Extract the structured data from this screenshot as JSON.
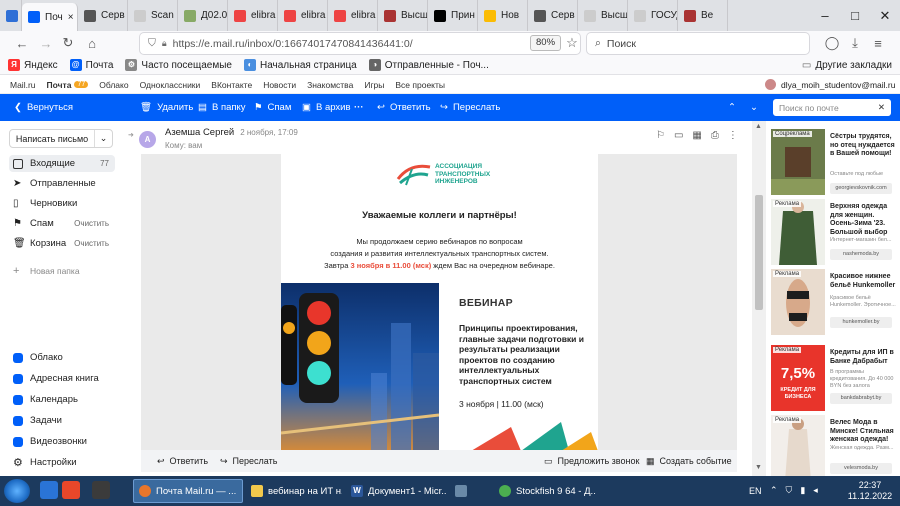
{
  "browser": {
    "tabs": [
      {
        "label": "",
        "fav": "#2f6fd6"
      },
      {
        "label": "Поч",
        "fav": "#005ff9",
        "active": true
      },
      {
        "label": "Серв",
        "fav": "#555"
      },
      {
        "label": "Scan о Д",
        "fav": "#ccc"
      },
      {
        "label": "Д02.0",
        "fav": "#8a6"
      },
      {
        "label": "elibra",
        "fav": "#e44"
      },
      {
        "label": "elibra",
        "fav": "#e44"
      },
      {
        "label": "elibra",
        "fav": "#e44"
      },
      {
        "label": "Высш",
        "fav": "#a33"
      },
      {
        "label": "Прин",
        "fav": "#000"
      },
      {
        "label": "Нов",
        "fav": "#fbbc04"
      },
      {
        "label": "Серв",
        "fav": "#555"
      },
      {
        "label": "Высшая",
        "fav": "#ccc"
      },
      {
        "label": "ГОСУДАР",
        "fav": "#ccc"
      },
      {
        "label": "Ве",
        "fav": "#a33"
      }
    ],
    "url": "https://e.mail.ru/inbox/0:16674017470841436441:0/",
    "zoom": "80%",
    "search_placeholder": "Поиск",
    "bookmarks": [
      "Яндекс",
      "Почта",
      "Часто посещаемые",
      "Начальная страница",
      "Отправленные - Поч..."
    ],
    "other_bookmarks": "Другие закладки"
  },
  "mail": {
    "top_links": [
      "Mail.ru",
      "Почта",
      "Облако",
      "Одноклассники",
      "ВКонтакте",
      "Новости",
      "Знакомства",
      "Игры",
      "Все проекты"
    ],
    "mail_badge": "77",
    "user": "dlya_moih_studentov@mail.ru",
    "toolbar": {
      "back": "Вернуться",
      "delete": "Удалить",
      "to_folder": "В папку",
      "spam": "Спам",
      "archive": "В архив",
      "more": "···",
      "reply": "Ответить",
      "forward": "Переслать",
      "search_placeholder": "Поиск по почте"
    },
    "sidebar": {
      "compose": "Написать письмо",
      "folders": [
        {
          "label": "Входящие",
          "count": "77"
        },
        {
          "label": "Отправленные",
          "count": ""
        },
        {
          "label": "Черновики",
          "count": ""
        },
        {
          "label": "Спам",
          "count": "Очистить"
        },
        {
          "label": "Корзина",
          "count": "Очистить"
        }
      ],
      "new_folder": "Новая папка",
      "apps": [
        "Облако",
        "Адресная книга",
        "Календарь",
        "Задачи",
        "Видеозвонки",
        "Настройки"
      ]
    },
    "message": {
      "sender": "Аземша Сергей",
      "date": "2 ноября, 17:09",
      "to": "Кому: вам",
      "avatar_letter": "А",
      "logo_text": [
        "АССОЦИАЦИЯ",
        "ТРАНСПОРТНЫХ",
        "ИНЖЕНЕРОВ"
      ],
      "greeting": "Уважаемые коллеги и партнёры!",
      "line1": "Мы продолжаем серию вебинаров по вопросам",
      "line2": "создания и развития интеллектуальных транспортных систем.",
      "line3_pre": "Завтра ",
      "line3_hl": "3 ноября в 11.00 (мск)",
      "line3_post": " ждем Вас на очередном вебинаре.",
      "webinar": "ВЕБИНАР",
      "topic": "Принципы проектирования, главные задачи подготовки и результаты реализации проектов по созданию интеллектуальных транспортных систем",
      "when": "3 ноября | 11.00 (мск)"
    },
    "footer": {
      "reply": "Ответить",
      "forward": "Переслать",
      "call": "Предложить звонок",
      "event": "Создать событие"
    }
  },
  "ads": [
    {
      "label": "Соцреклама",
      "title": "Сёстры трудятся, но отец нуждается в Вашей помощи!",
      "desc": "Оставьте под любые",
      "domain": "georgievskovnik.com"
    },
    {
      "label": "Реклама",
      "title": "Верхняя одежда для женщин. Осень-Зима '23. Большой выбор",
      "desc": "Интернет-магазин бел...",
      "domain": "nashemoda.by"
    },
    {
      "label": "Реклама",
      "title": "Красивое нижнее бельё Hunkemoller",
      "desc": "Красивое бельё Hunkemoller. Эротичное...",
      "domain": "hunkemoller.by"
    },
    {
      "label": "Реклама",
      "title": "Кредиты для ИП в Банке Дабрабыт",
      "desc": "В программы кредитования. До 40 000 BYN без залога",
      "domain": "bankdabrabyt.by",
      "promo": "7,5%",
      "promo2": "КРЕДИТ ДЛЯ БИЗНЕСА"
    },
    {
      "label": "Реклама",
      "title": "Велес Мода в Минске! Стильная женская одежда!",
      "desc": "Женская одежда. Разм...",
      "domain": "velesmoda.by"
    }
  ],
  "taskbar": {
    "items": [
      "Почта Mail.ru — ...",
      "вебинар на ИТ н...",
      "Документ1 - Micr...",
      "",
      "Stockfish 9 64 - Д..."
    ],
    "lang": "EN",
    "time": "22:37",
    "date": "11.12.2022"
  }
}
